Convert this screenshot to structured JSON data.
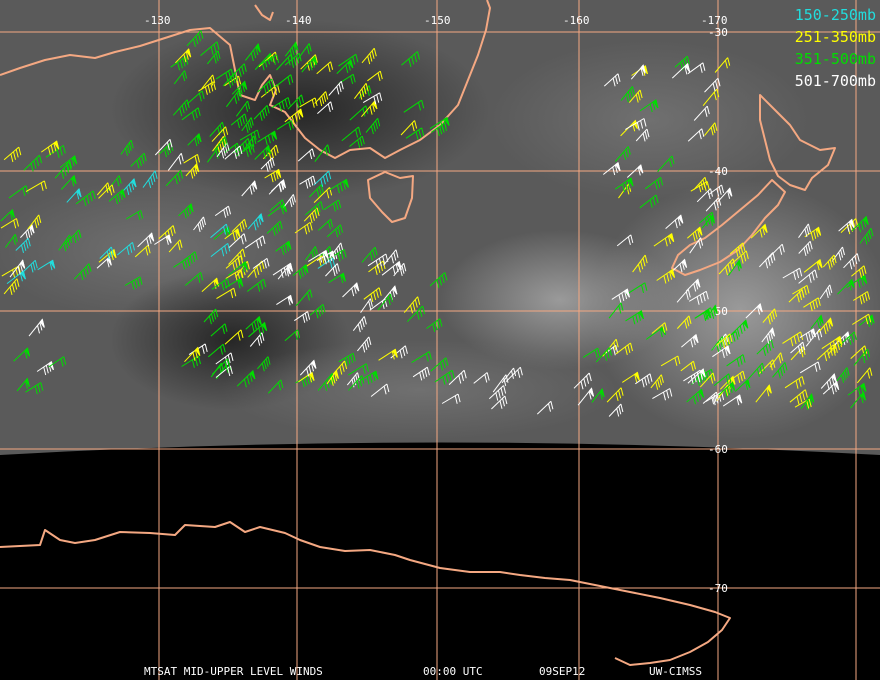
{
  "legend": [
    {
      "label": "150-250mb",
      "color": "#22dddd"
    },
    {
      "label": "251-350mb",
      "color": "#ffff00"
    },
    {
      "label": "351-500mb",
      "color": "#00dd00"
    },
    {
      "label": "501-700mb",
      "color": "#ffffff"
    }
  ],
  "lon_labels": [
    "-130",
    "-140",
    "-150",
    "-160",
    "-170"
  ],
  "lat_labels": [
    "-30",
    "-40",
    "-50",
    "-60",
    "-70"
  ],
  "footer": {
    "product": "MTSAT MID-UPPER LEVEL WINDS",
    "time": "00:00 UTC",
    "date": "09SEP12",
    "source": "UW-CIMSS"
  },
  "colors": {
    "grid": "#f4a882",
    "coast": "#f4a882",
    "space": "#000000"
  }
}
